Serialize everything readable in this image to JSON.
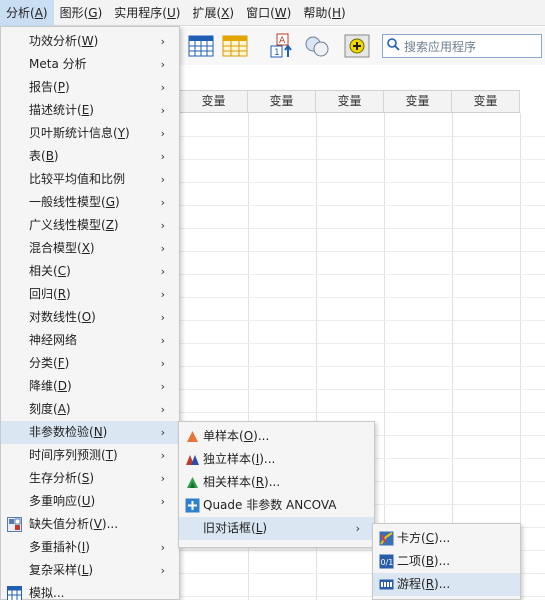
{
  "menubar": {
    "items": [
      {
        "label": "分析(",
        "key": "A",
        "tail": ")"
      },
      {
        "label": "图形(",
        "key": "G",
        "tail": ")"
      },
      {
        "label": "实用程序(",
        "key": "U",
        "tail": ")"
      },
      {
        "label": "扩展(",
        "key": "X",
        "tail": ")"
      },
      {
        "label": "窗口(",
        "key": "W",
        "tail": ")"
      },
      {
        "label": "帮助(",
        "key": "H",
        "tail": ")"
      }
    ]
  },
  "search": {
    "placeholder": "搜索应用程序"
  },
  "grid": {
    "column_header": "变量"
  },
  "analyze_menu": {
    "items": [
      {
        "label": "功效分析(",
        "key": "W",
        "tail": ")",
        "arrow": "›"
      },
      {
        "label": "Meta 分析",
        "key": "",
        "tail": "",
        "arrow": "›"
      },
      {
        "label": "报告(",
        "key": "P",
        "tail": ")",
        "arrow": "›"
      },
      {
        "label": "描述统计(",
        "key": "E",
        "tail": ")",
        "arrow": "›"
      },
      {
        "label": "贝叶斯统计信息(",
        "key": "Y",
        "tail": ")",
        "arrow": "›"
      },
      {
        "label": "表(",
        "key": "B",
        "tail": ")",
        "arrow": "›"
      },
      {
        "label": "比较平均值和比例",
        "key": "",
        "tail": "",
        "arrow": "›"
      },
      {
        "label": "一般线性模型(",
        "key": "G",
        "tail": ")",
        "arrow": "›"
      },
      {
        "label": "广义线性模型(",
        "key": "Z",
        "tail": ")",
        "arrow": "›"
      },
      {
        "label": "混合模型(",
        "key": "X",
        "tail": ")",
        "arrow": "›"
      },
      {
        "label": "相关(",
        "key": "C",
        "tail": ")",
        "arrow": "›"
      },
      {
        "label": "回归(",
        "key": "R",
        "tail": ")",
        "arrow": "›"
      },
      {
        "label": "对数线性(",
        "key": "O",
        "tail": ")",
        "arrow": "›"
      },
      {
        "label": "神经网络",
        "key": "",
        "tail": "",
        "arrow": "›"
      },
      {
        "label": "分类(",
        "key": "F",
        "tail": ")",
        "arrow": "›"
      },
      {
        "label": "降维(",
        "key": "D",
        "tail": ")",
        "arrow": "›"
      },
      {
        "label": "刻度(",
        "key": "A",
        "tail": ")",
        "arrow": "›"
      },
      {
        "label": "非参数检验(",
        "key": "N",
        "tail": ")",
        "arrow": "›"
      },
      {
        "label": "时间序列预测(",
        "key": "T",
        "tail": ")",
        "arrow": "›"
      },
      {
        "label": "生存分析(",
        "key": "S",
        "tail": ")",
        "arrow": "›"
      },
      {
        "label": "多重响应(",
        "key": "U",
        "tail": ")",
        "arrow": "›"
      },
      {
        "label": "缺失值分析(",
        "key": "V",
        "tail": ")...",
        "arrow": ""
      },
      {
        "label": "多重插补(",
        "key": "I",
        "tail": ")",
        "arrow": "›"
      },
      {
        "label": "复杂采样(",
        "key": "L",
        "tail": ")",
        "arrow": "›"
      },
      {
        "label": "模拟...",
        "key": "",
        "tail": "",
        "arrow": ""
      }
    ]
  },
  "nonparam_menu": {
    "items": [
      {
        "label": "单样本(",
        "key": "O",
        "tail": ")...",
        "arrow": ""
      },
      {
        "label": "独立样本(",
        "key": "I",
        "tail": ")...",
        "arrow": ""
      },
      {
        "label": "相关样本(",
        "key": "R",
        "tail": ")...",
        "arrow": ""
      },
      {
        "label": "Quade 非参数 ANCOVA",
        "key": "",
        "tail": "",
        "arrow": ""
      },
      {
        "label": "旧对话框(",
        "key": "L",
        "tail": ")",
        "arrow": "›"
      }
    ]
  },
  "legacy_menu": {
    "items": [
      {
        "label": "卡方(",
        "key": "C",
        "tail": ")...",
        "arrow": ""
      },
      {
        "label": "二项(",
        "key": "B",
        "tail": ")...",
        "arrow": ""
      },
      {
        "label": "游程(",
        "key": "R",
        "tail": ")...",
        "arrow": ""
      }
    ]
  },
  "colors": {
    "highlight": "#dbe6f3",
    "menu_active": "#c9ddf3",
    "accent": "#1f5fb4"
  }
}
